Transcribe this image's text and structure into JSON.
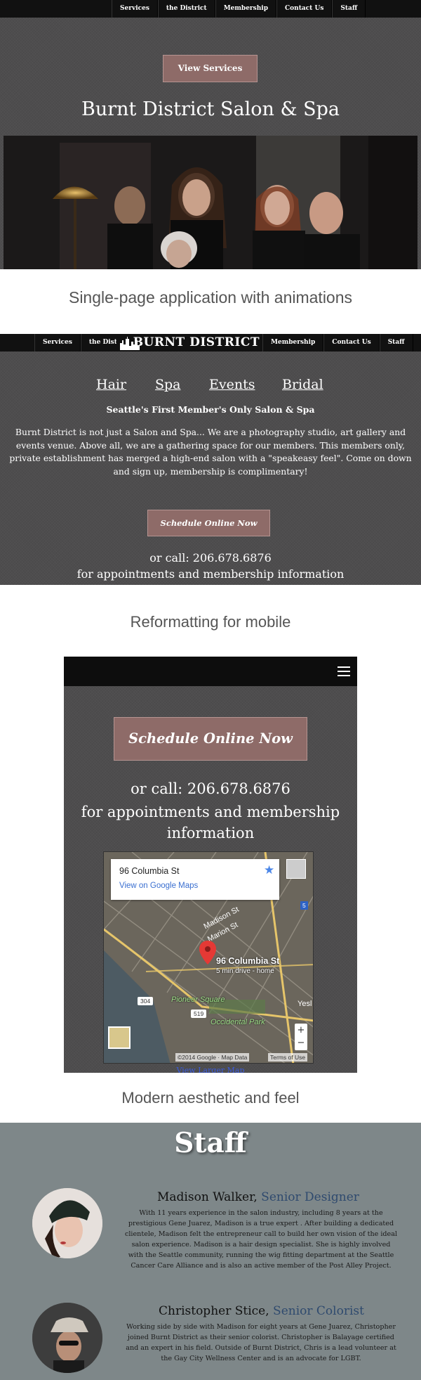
{
  "section1": {
    "nav": [
      "Services",
      "the District",
      "Membership",
      "Contact Us",
      "Staff"
    ],
    "view_services_label": "View Services",
    "title": "Burnt District Salon & Spa"
  },
  "caption1": "Single-page application with animations",
  "section2": {
    "nav_left": [
      "Services",
      "the District"
    ],
    "logo": "BURNT DISTRICT",
    "nav_right": [
      "Membership",
      "Contact Us",
      "Staff"
    ],
    "categories": [
      "Hair",
      "Spa",
      "Events",
      "Bridal"
    ],
    "tagline": "Seattle's First Member's Only Salon & Spa",
    "intro": "Burnt District is not just a Salon and Spa... We are a photography studio, art gallery and events venue. Above all, we are a gathering space for our members.  This members only, private establishment has merged a high-end salon with a \"speakeasy feel\".  Come on down and sign up, membership is complimentary!",
    "schedule_label": "Schedule Online Now",
    "call_line": "or call: 206.678.6876",
    "appointments_line": "for appointments and membership information"
  },
  "caption2": "Reformatting for mobile",
  "section3": {
    "menu_icon": "hamburger-icon",
    "schedule_label": "Schedule Online Now",
    "call_line": "or call: 206.678.6876",
    "appointments_line": "for appointments and membership information",
    "map": {
      "place_title": "96 Columbia St",
      "place_link": "View on Google Maps",
      "pin_title": "96 Columbia St",
      "pin_sub": "5 min drive - home",
      "streets": [
        "Madison St",
        "Marion St",
        "Pioneer Square",
        "Occidental Park",
        "Yesl"
      ],
      "road_numbers": [
        "304",
        "519",
        "5"
      ],
      "attribution": "©2014 Google · Map Data",
      "terms": "Terms of Use",
      "zoom_in": "+",
      "zoom_out": "−",
      "view_larger": "View Larger Map"
    }
  },
  "caption3": "Modern aesthetic and feel",
  "staff": {
    "title": "Staff",
    "members": [
      {
        "name": "Madison Walker,",
        "role": "Senior Designer",
        "bio_lines": [
          "With 11 years experience in the salon industry, including 8 years at the",
          "prestigious Gene Juarez, Madison is a true expert . After building a dedicated",
          "clientele, Madison felt the entrepreneur call to build her own vision of the ideal",
          "salon experience. Madison is a hair design specialist. She is highly involved",
          "with the Seattle community, running the wig fitting department at the Seattle",
          "Cancer Care Alliance and is also an active member of the Post Alley Project."
        ]
      },
      {
        "name": "Christopher Stice,",
        "role": "Senior Colorist",
        "bio_lines": [
          "Working side by side with Madison for eight years at Gene Juarez, Christopher",
          "joined Burnt District as their senior colorist. Christopher is Balayage certified",
          "and an expert in his field. Outside of Burnt District, Chris is a lead volunteer at",
          "the Gay City Wellness Center and is an advocate for LGBT."
        ]
      }
    ]
  }
}
